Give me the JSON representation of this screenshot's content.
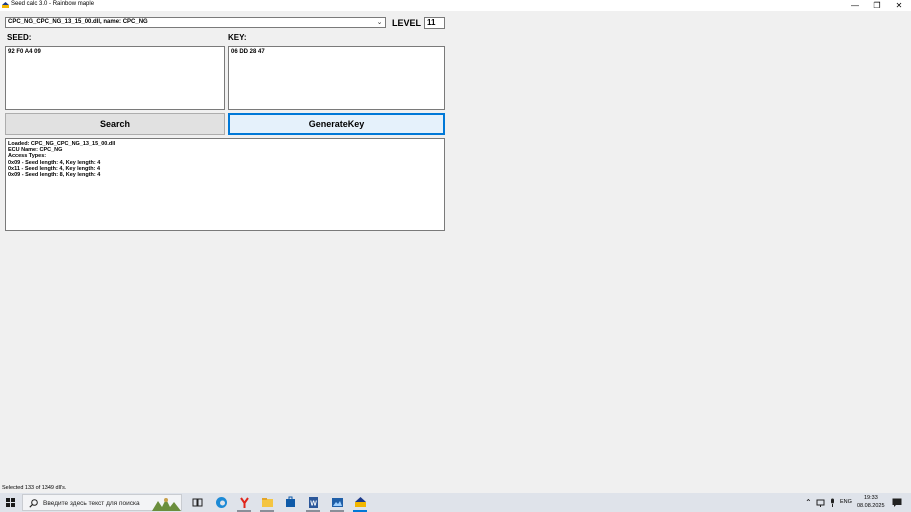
{
  "window": {
    "title": "Seed calc 3.0 - Rainbow maple",
    "minimize": "—",
    "restore": "❐",
    "close": "✕"
  },
  "combo": {
    "value": "CPC_NG_CPC_NG_13_15_00.dll, name: CPC_NG",
    "arrow": "⌄"
  },
  "level": {
    "label": "LEVEL",
    "value": "11"
  },
  "seed": {
    "label": "SEED:",
    "value": "92 F0 A4 09"
  },
  "key": {
    "label": "KEY:",
    "value": "06 DD 28 47"
  },
  "buttons": {
    "search": "Search",
    "generate": "GenerateKey"
  },
  "log": [
    "Loaded: CPC_NG_CPC_NG_13_15_00.dll",
    "ECU Name: CPC_NG",
    "Access Types:",
    "0x09 - Seed length: 4, Key length: 4",
    "0x11 - Seed length: 4, Key length: 4",
    "0x09 - Seed length: 8, Key length: 4"
  ],
  "status": "Selected 133 of 1349 dll's.",
  "taskbar": {
    "search_placeholder": "Введите здесь текст для поиска",
    "language": "ENG",
    "time": "19:33",
    "date": "08.08.2025",
    "apps": [
      "task-view",
      "edge",
      "yandex",
      "explorer",
      "store",
      "word",
      "photos",
      "seed-calc"
    ],
    "accent": "#0078d7"
  }
}
